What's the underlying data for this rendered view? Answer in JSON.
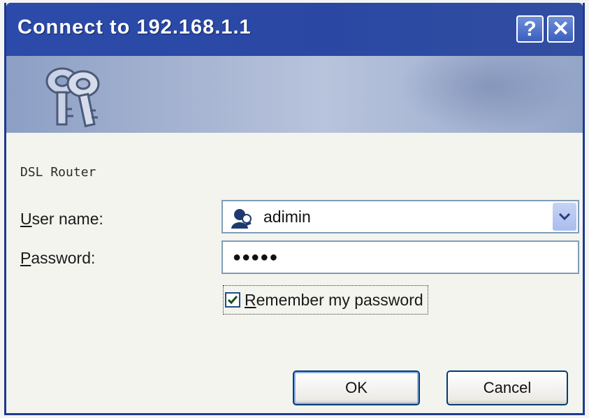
{
  "window": {
    "title": "Connect to 192.168.1.1",
    "help_button": "?",
    "close_button": "✕"
  },
  "realm": "DSL Router",
  "form": {
    "username_label_ul": "U",
    "username_label_rest": "ser name:",
    "username_value": "adimin",
    "password_label_ul": "P",
    "password_label_rest": "assword:",
    "password_value": "●●●●●",
    "remember_label_ul": "R",
    "remember_label_rest": "emember my password",
    "remember_checked": true
  },
  "buttons": {
    "ok_label": "OK",
    "cancel_label": "Cancel"
  },
  "icons": {
    "banner": "keys-icon",
    "user": "user-account-icon",
    "dropdown": "chevron-down-icon",
    "checkmark": "checkmark-icon"
  },
  "colors": {
    "titlebar": "#2c4aa9",
    "banner": "#a5b3d1",
    "input_border": "#7f9db9"
  }
}
